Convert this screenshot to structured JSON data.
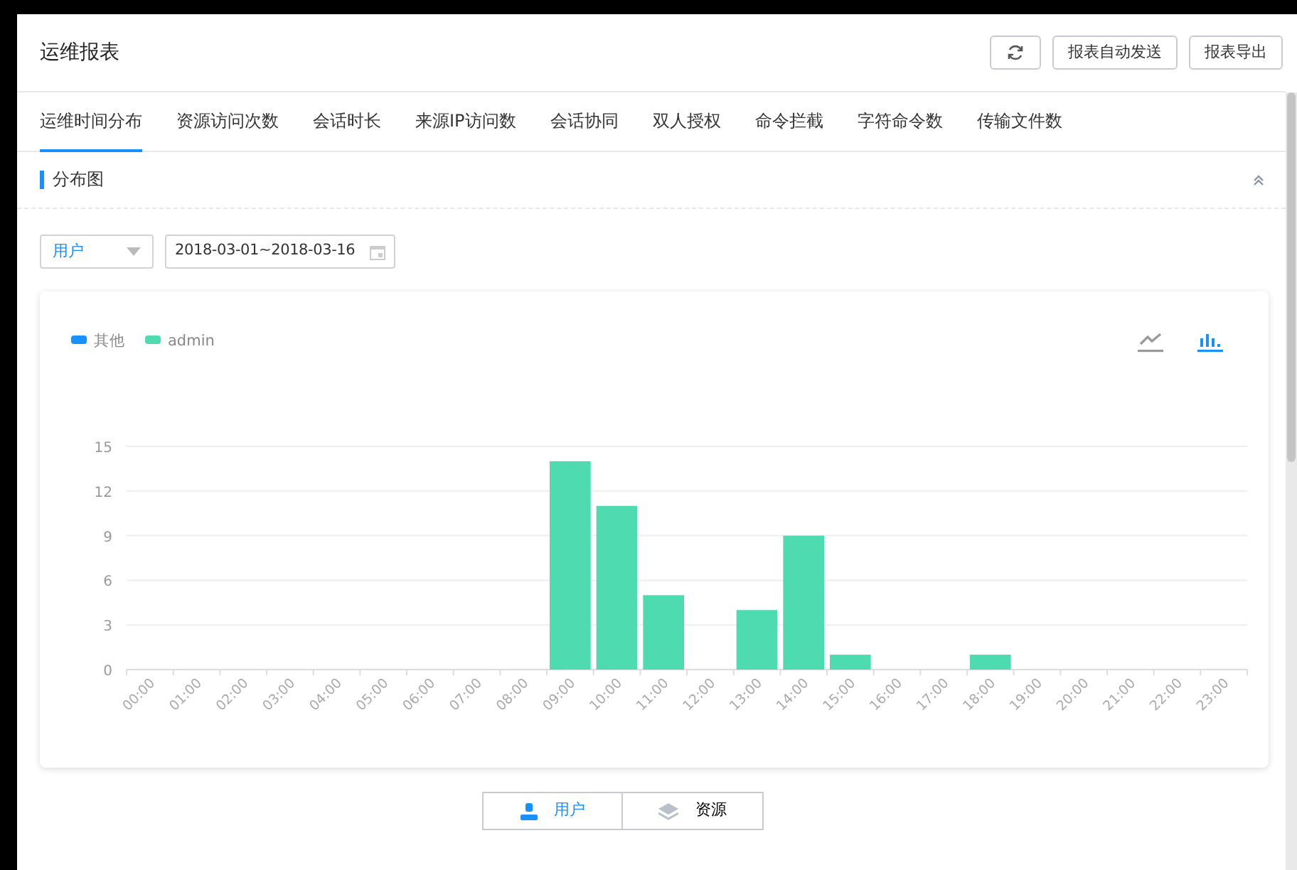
{
  "header": {
    "title": "运维报表",
    "buttons": [
      {
        "kind": "refresh"
      },
      {
        "kind": "text",
        "label": "报表自动发送"
      },
      {
        "kind": "text",
        "label": "报表导出"
      }
    ]
  },
  "tabs": [
    {
      "label": "运维时间分布",
      "selected": true
    },
    {
      "label": "资源访问次数",
      "selected": false
    },
    {
      "label": "会话时长",
      "selected": false
    },
    {
      "label": "来源IP访问数",
      "selected": false
    },
    {
      "label": "会话协同",
      "selected": false
    },
    {
      "label": "双人授权",
      "selected": false
    },
    {
      "label": "命令拦截",
      "selected": false
    },
    {
      "label": "字符命令数",
      "selected": false
    },
    {
      "label": "传输文件数",
      "selected": false
    }
  ],
  "section": {
    "title": "分布图",
    "expanded": true
  },
  "filters": {
    "dimension": "用户",
    "date_range": "2018-03-01~2018-03-16"
  },
  "chart_types": [
    {
      "kind": "line",
      "selected": false
    },
    {
      "kind": "bar",
      "selected": true
    }
  ],
  "chart_data": {
    "type": "bar",
    "stacked": true,
    "grid": true,
    "ylim": [
      0,
      15
    ],
    "yticks": [
      0,
      3,
      6,
      9,
      12,
      15
    ],
    "categories": [
      "00:00",
      "01:00",
      "02:00",
      "03:00",
      "04:00",
      "05:00",
      "06:00",
      "07:00",
      "08:00",
      "09:00",
      "10:00",
      "11:00",
      "12:00",
      "13:00",
      "14:00",
      "15:00",
      "16:00",
      "17:00",
      "18:00",
      "19:00",
      "20:00",
      "21:00",
      "22:00",
      "23:00"
    ],
    "series": [
      {
        "name": "其他",
        "color": "#1890ff",
        "values": [
          0,
          0,
          0,
          0,
          0,
          0,
          0,
          0,
          0,
          0,
          0,
          0,
          0,
          0,
          0,
          0,
          0,
          0,
          0,
          0,
          0,
          0,
          0,
          0
        ]
      },
      {
        "name": "admin",
        "color": "#4fdbb0",
        "values": [
          0,
          0,
          0,
          0,
          0,
          0,
          0,
          0,
          0,
          14,
          11,
          5,
          0,
          4,
          9,
          1,
          0,
          0,
          1,
          0,
          0,
          0,
          0,
          0
        ]
      }
    ]
  },
  "view_toggle": [
    {
      "kind": "user",
      "label": "用户",
      "selected": true
    },
    {
      "kind": "resource",
      "label": "资源",
      "selected": false
    }
  ]
}
